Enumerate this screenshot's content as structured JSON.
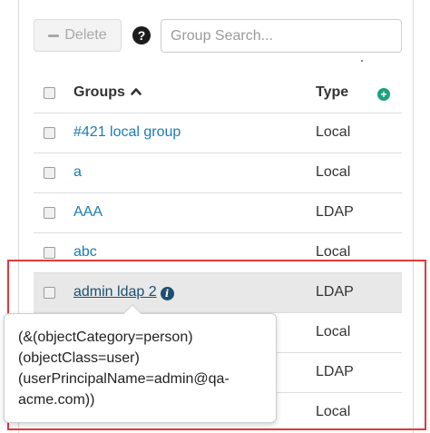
{
  "toolbar": {
    "delete_label": "Delete",
    "help_glyph": "?",
    "search_placeholder": "Group Search..."
  },
  "table": {
    "headers": {
      "name": "Groups",
      "type": "Type"
    },
    "add_glyph": "+",
    "rows": [
      {
        "name": "#421 local group",
        "type": "Local"
      },
      {
        "name": "a",
        "type": "Local"
      },
      {
        "name": "AAA",
        "type": "LDAP"
      },
      {
        "name": "abc",
        "type": "Local"
      },
      {
        "name": "admin ldap 2",
        "type": "LDAP"
      },
      {
        "name": "",
        "type": "Local"
      },
      {
        "name": "",
        "type": "LDAP"
      },
      {
        "name": "",
        "type": "Local"
      }
    ]
  },
  "tooltip": {
    "lines": [
      "(&(objectCategory=person)",
      "(objectClass=user)",
      "(userPrincipalName=admin@qa-",
      "acme.com))"
    ]
  },
  "colors": {
    "link": "#1a7bb5",
    "accent_add": "#1ea17f",
    "highlight_border": "#e0393b"
  }
}
